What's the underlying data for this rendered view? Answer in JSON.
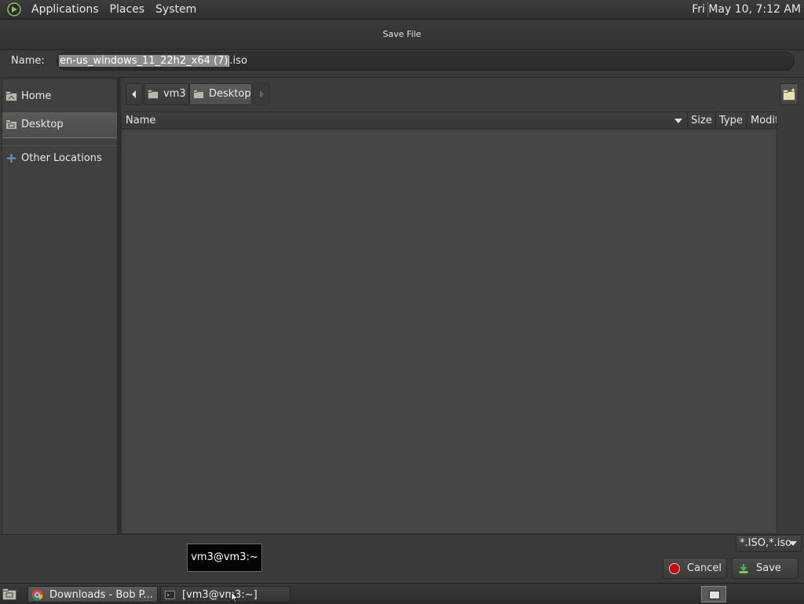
{
  "top_panel": {
    "menus": [
      "Applications",
      "Places",
      "System"
    ],
    "clock": "Fri May 10,  7:12 AM"
  },
  "dialog": {
    "title": "Save File",
    "name_label": "Name:",
    "filename_selected": "en-us_windows_11_22h2_x64 (7)",
    "filename_ext": ".iso"
  },
  "sidebar": {
    "items": [
      {
        "label": "Home"
      },
      {
        "label": "Desktop"
      },
      {
        "label": "Other Locations"
      }
    ]
  },
  "pathbar": {
    "segments": [
      "vm3",
      "Desktop"
    ]
  },
  "filelist": {
    "columns": [
      "Name",
      "Size",
      "Type",
      "Modified"
    ]
  },
  "filter": {
    "selected": "*.ISO,*.iso"
  },
  "buttons": {
    "cancel": "Cancel",
    "save": "Save"
  },
  "tooltip": "vm3@vm3:~",
  "taskbar": {
    "tasks": [
      {
        "label": "Downloads - Bob P..."
      },
      {
        "label": "[vm3@vm3:~]"
      }
    ]
  },
  "colors": {
    "accent_cancel": "#d40000",
    "accent_save": "#4caf50",
    "folder": "#b8b8a8"
  }
}
